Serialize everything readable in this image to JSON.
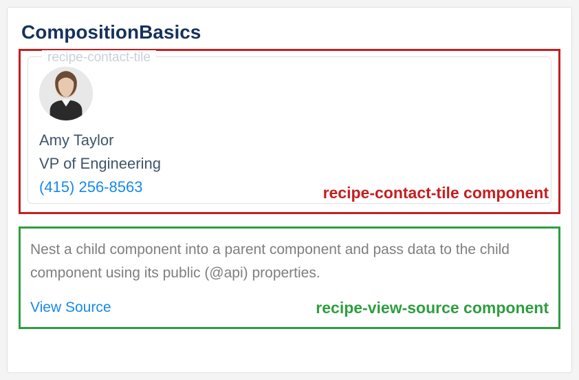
{
  "card": {
    "title": "CompositionBasics"
  },
  "contactTile": {
    "legend": "recipe-contact-tile",
    "name": "Amy Taylor",
    "jobTitle": "VP of Engineering",
    "phone": "(415) 256-8563",
    "annotation": "recipe-contact-tile component"
  },
  "viewSource": {
    "description": "Nest a child component into a parent component and pass data to the child component using its public (@api) properties.",
    "linkLabel": "View Source",
    "annotation": "recipe-view-source component"
  },
  "colors": {
    "redBox": "#c41e1e",
    "greenBox": "#2e9e3f",
    "link": "#1589ee",
    "headerText": "#16325c"
  }
}
